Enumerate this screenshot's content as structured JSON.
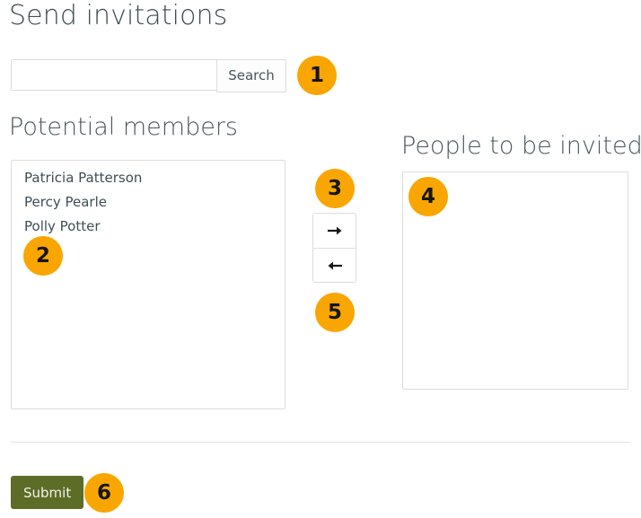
{
  "page": {
    "title": "Send invitations"
  },
  "search": {
    "value": "",
    "placeholder": "",
    "button_label": "Search"
  },
  "potential_members": {
    "heading": "Potential members",
    "options": [
      "Patricia Patterson",
      "Percy Pearle",
      "Polly Potter"
    ]
  },
  "people_to_be_invited": {
    "heading": "People to be invited",
    "options": []
  },
  "transfer_controls": {
    "add_label": "→",
    "remove_label": "←",
    "add_icon": "arrow-right-icon",
    "remove_icon": "arrow-left-icon"
  },
  "form": {
    "submit_label": "Submit"
  },
  "annotations": [
    {
      "id": "1",
      "label": "1"
    },
    {
      "id": "2",
      "label": "2"
    },
    {
      "id": "3",
      "label": "3"
    },
    {
      "id": "4",
      "label": "4"
    },
    {
      "id": "5",
      "label": "5"
    },
    {
      "id": "6",
      "label": "6"
    }
  ],
  "colors": {
    "badge_background": "#f9a602",
    "badge_text": "#151515",
    "submit_background": "#5d6c26",
    "submit_text": "#f2f2ee",
    "heading_text": "#4a585e",
    "border": "#dcdcdc"
  }
}
